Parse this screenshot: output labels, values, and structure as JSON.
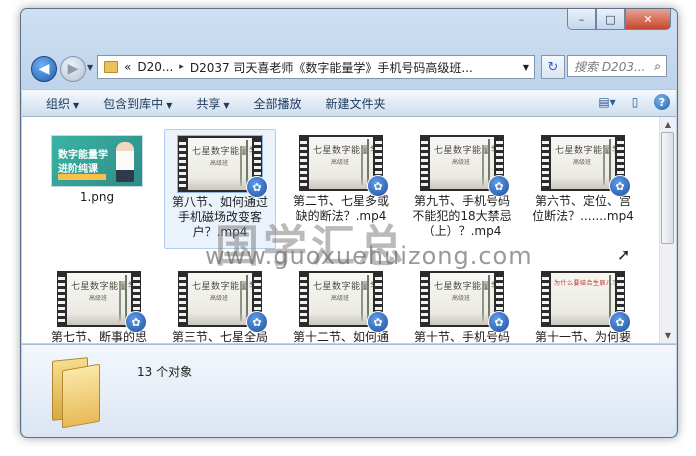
{
  "window": {
    "caption": {
      "minimize": "–",
      "maximize": "□",
      "close": "✕"
    }
  },
  "nav": {
    "back_icon": "arrow-left-icon",
    "forward_icon": "arrow-right-icon",
    "address": {
      "overflow": "«",
      "segment1": "D20...",
      "separator": "▸",
      "segment2": "D2037 司天喜老师《数字能量学》手机号码高级班..."
    },
    "search_placeholder": "搜索 D203...",
    "refresh_icon": "refresh-icon",
    "search_icon": "magnifier-icon"
  },
  "toolbar": {
    "organize": "组织",
    "include_in_library": "包含到库中",
    "share": "共享",
    "play_all": "全部播放",
    "new_folder": "新建文件夹",
    "caret": "▼"
  },
  "files": [
    {
      "name": "1.png",
      "type": "image",
      "thumb_title1": "数字能量学",
      "thumb_title2": "进阶纯课"
    },
    {
      "name": "第八节、如何通过手机磁场改变客户？.mp4",
      "type": "video",
      "thumb_title": "七星数字能量学",
      "thumb_sub": "高级班"
    },
    {
      "name": "第二节、七星多或缺的断法？.mp4",
      "type": "video",
      "thumb_title": "七星数字能量学",
      "thumb_sub": "高级班"
    },
    {
      "name": "第九节、手机号码不能犯的18大禁忌（上）？.mp4",
      "type": "video",
      "thumb_title": "七星数字能量学",
      "thumb_sub": "高级班"
    },
    {
      "name": "第六节、定位、宫位断法？.......mp4",
      "type": "video",
      "thumb_title": "七星数字能量学",
      "thumb_sub": "高级班"
    },
    {
      "name": "第七节、断事的思路和逻辑？",
      "type": "video",
      "thumb_title": "七星数字能量学",
      "thumb_sub": "高级班"
    },
    {
      "name": "第三节、七星全局解释（上）？",
      "type": "video",
      "thumb_title": "七星数字能量学",
      "thumb_sub": "高级班"
    },
    {
      "name": "第十二节、如何通过手机号码为",
      "type": "video",
      "thumb_title": "七星数字能量学",
      "thumb_sub": "高级班"
    },
    {
      "name": "第十节、手机号码犯了不能犯的",
      "type": "video",
      "thumb_title": "七星数字能量学",
      "thumb_sub": "高级班"
    },
    {
      "name": "第十一节、为何要结合八字来选",
      "type": "video",
      "thumb_title": "七星数字能量学",
      "thumb_sub": "为什么要结合生辰八字来选号码？"
    }
  ],
  "watermark": {
    "line1": "国学汇总",
    "line2": "www.guoxuehuizong.com"
  },
  "details": {
    "count": "13 个对象"
  }
}
